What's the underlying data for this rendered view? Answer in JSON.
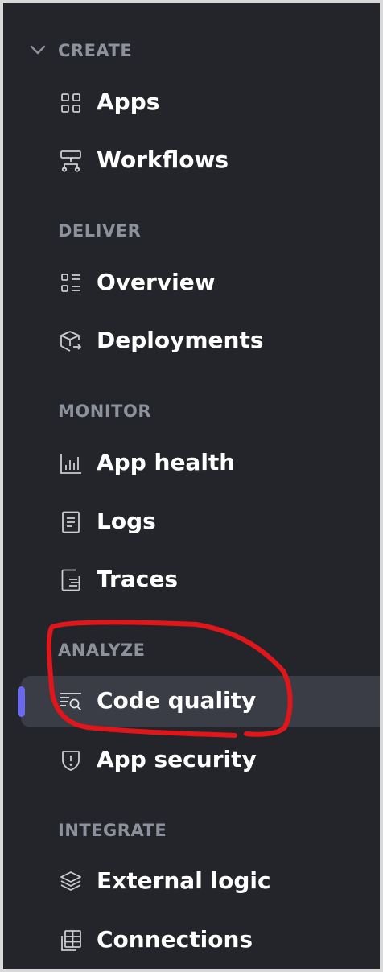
{
  "sidebar": {
    "sections": [
      {
        "title": "CREATE",
        "collapsible": true,
        "items": [
          {
            "label": "Apps",
            "icon": "grid-icon"
          },
          {
            "label": "Workflows",
            "icon": "workflow-icon"
          }
        ]
      },
      {
        "title": "DELIVER",
        "items": [
          {
            "label": "Overview",
            "icon": "list-icon"
          },
          {
            "label": "Deployments",
            "icon": "package-icon"
          }
        ]
      },
      {
        "title": "MONITOR",
        "items": [
          {
            "label": "App health",
            "icon": "bar-chart-icon"
          },
          {
            "label": "Logs",
            "icon": "document-icon"
          },
          {
            "label": "Traces",
            "icon": "trace-icon"
          }
        ]
      },
      {
        "title": "ANALYZE",
        "items": [
          {
            "label": "Code quality",
            "icon": "code-search-icon",
            "active": true
          },
          {
            "label": "App security",
            "icon": "shield-alert-icon"
          }
        ]
      },
      {
        "title": "INTEGRATE",
        "items": [
          {
            "label": "External logic",
            "icon": "layers-icon"
          },
          {
            "label": "Connections",
            "icon": "table-icon"
          }
        ]
      }
    ]
  },
  "colors": {
    "background": "#24252b",
    "section_title": "#8d919c",
    "item_text": "#ffffff",
    "active_background": "#3b3d46",
    "active_indicator": "#6b68f0",
    "annotation": "#e0161b"
  }
}
